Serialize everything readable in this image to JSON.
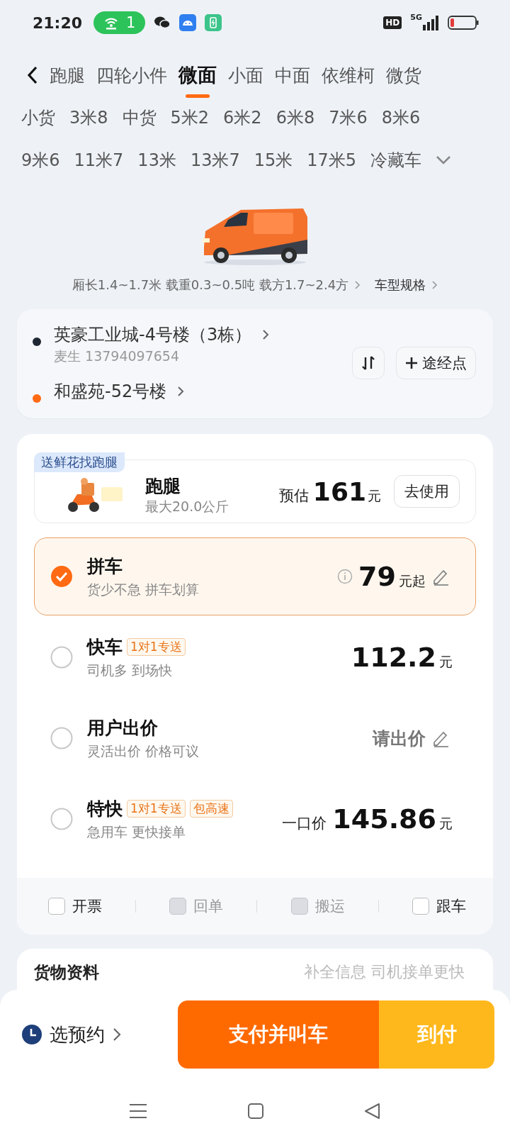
{
  "status_bar": {
    "time": "21:20",
    "hotspot_count": "1",
    "hd": "HD",
    "network": "5G"
  },
  "tab_rows": [
    {
      "tabs": [
        {
          "label": "跑腿",
          "selected": false
        },
        {
          "label": "四轮小件",
          "selected": false
        },
        {
          "label": "微面",
          "selected": true
        },
        {
          "label": "小面",
          "selected": false
        },
        {
          "label": "中面",
          "selected": false
        },
        {
          "label": "依维柯",
          "selected": false
        },
        {
          "label": "微货",
          "selected": false
        }
      ]
    },
    {
      "tabs": [
        {
          "label": "小货",
          "selected": false
        },
        {
          "label": "3米8",
          "selected": false
        },
        {
          "label": "中货",
          "selected": false
        },
        {
          "label": "5米2",
          "selected": false
        },
        {
          "label": "6米2",
          "selected": false
        },
        {
          "label": "6米8",
          "selected": false
        },
        {
          "label": "7米6",
          "selected": false
        },
        {
          "label": "8米6",
          "selected": false
        }
      ]
    },
    {
      "tabs": [
        {
          "label": "9米6",
          "selected": false
        },
        {
          "label": "11米7",
          "selected": false
        },
        {
          "label": "13米",
          "selected": false
        },
        {
          "label": "13米7",
          "selected": false
        },
        {
          "label": "15米",
          "selected": false
        },
        {
          "label": "17米5",
          "selected": false
        },
        {
          "label": "冷藏车",
          "selected": false
        }
      ]
    }
  ],
  "vehicle": {
    "kind": "picture",
    "specs": "厢长1.4~1.7米 载重0.3~0.5吨 载方1.7~2.4方",
    "spec_link": "车型规格"
  },
  "route": {
    "stops": [
      {
        "address": "英豪工业城-4号楼（3栋）",
        "contact": "麦生 13794097654",
        "color": "#1f2633"
      },
      {
        "address": "和盛苑-52号楼",
        "color": "#ff6a13"
      }
    ],
    "waypoint_button": "途经点"
  },
  "promo": {
    "tag": "送鲜花找跑腿",
    "title": "跑腿",
    "subtitle": "最大20.0公斤",
    "price_prefix": "预估",
    "amount": "161",
    "unit": "元",
    "button": "去使用"
  },
  "options": [
    {
      "kind": "price",
      "title": "拼车",
      "subtitle": "货少不急 拼车划算",
      "selected": true,
      "info": true,
      "editable": true,
      "amount": "79",
      "unit": "元起"
    },
    {
      "kind": "price",
      "title": "快车",
      "subtitle": "司机多 到场快",
      "tags": [
        "1对1专送"
      ],
      "selected": false,
      "info": false,
      "editable": false,
      "amount": "112.2",
      "unit": "元"
    },
    {
      "kind": "bid",
      "title": "用户出价",
      "subtitle": "灵活出价 价格可议",
      "selected": false,
      "info": false,
      "editable": true,
      "prompt": "请出价"
    },
    {
      "kind": "price",
      "title": "特快",
      "subtitle": "急用车 更快接单",
      "tags": [
        "1对1专送",
        "包高速"
      ],
      "selected": false,
      "info": false,
      "editable": false,
      "price_prefix": "一口价",
      "amount": "145.86",
      "unit": "元"
    }
  ],
  "extras": [
    {
      "label": "开票",
      "checked": false,
      "disabled": false
    },
    {
      "label": "回单",
      "checked": false,
      "disabled": true
    },
    {
      "label": "搬运",
      "checked": false,
      "disabled": true
    },
    {
      "label": "跟车",
      "checked": false,
      "disabled": false
    }
  ],
  "cargo": {
    "title": "货物资料",
    "hint": "补全信息 司机接单更快"
  },
  "bottom_bar": {
    "schedule": "选预约",
    "pay_button": "支付并叫车",
    "cod_button": "到付"
  }
}
